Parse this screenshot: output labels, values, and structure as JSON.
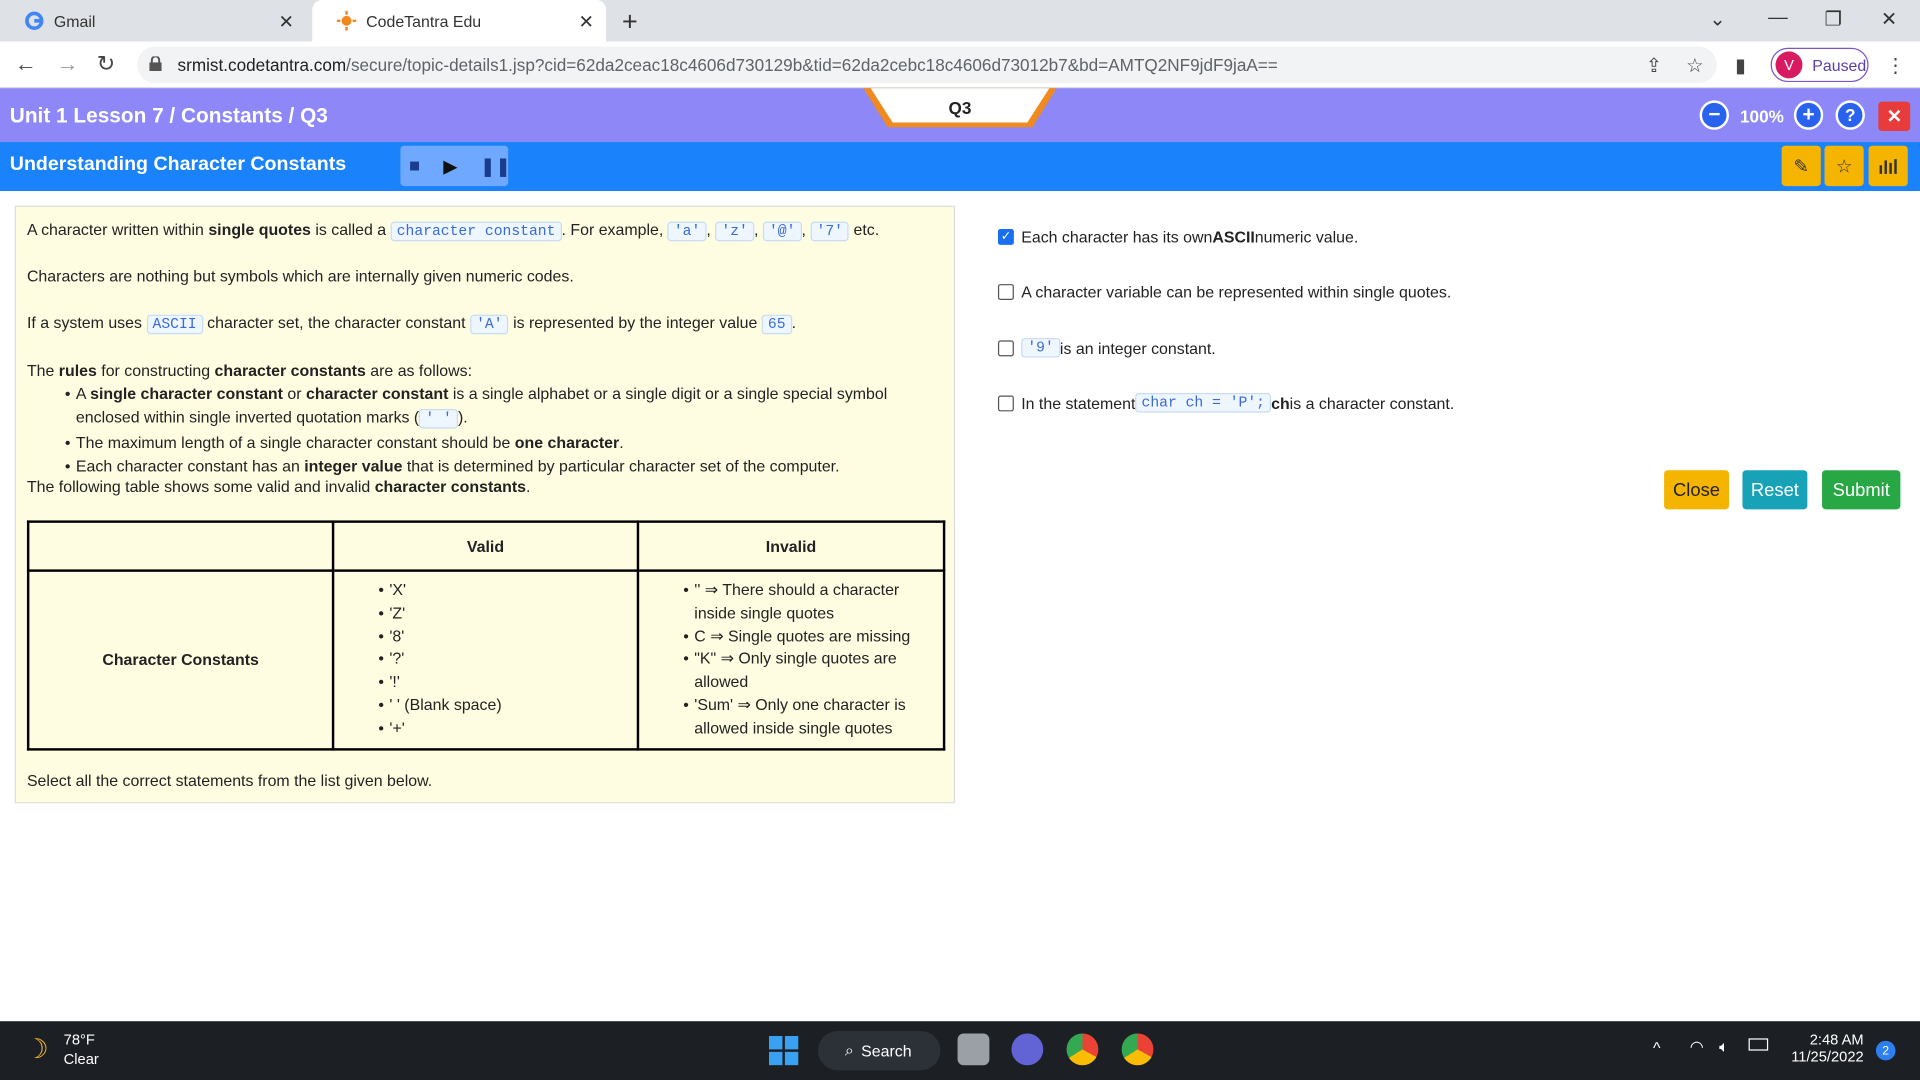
{
  "browser": {
    "tabs": [
      {
        "title": "Gmail"
      },
      {
        "title": "CodeTantra Edu"
      }
    ],
    "url_host": "srmist.codetantra.com",
    "url_path": "/secure/topic-details1.jsp?cid=62da2ceac18c4606d730129b&tid=62da2cebc18c4606d73012b7&bd=AMTQ2NF9jdF9jaA==",
    "profile_initial": "V",
    "profile_status": "Paused"
  },
  "lesson": {
    "breadcrumb": "Unit 1 Lesson 7 / Constants / Q3",
    "question_tab": "Q3",
    "zoom": "100%",
    "title": "Understanding Character Constants"
  },
  "content": {
    "p1_a": "A character written within ",
    "p1_b": "single quotes",
    "p1_c": " is called a ",
    "p1_code": "character constant",
    "p1_d": ". For example, ",
    "examples": [
      "'a'",
      "'z'",
      "'@'",
      "'7'"
    ],
    "p1_e": " etc.",
    "p2": "Characters are nothing but symbols which are internally given numeric codes.",
    "p3_a": "If a system uses ",
    "p3_code1": "ASCII",
    "p3_b": " character set, the character constant ",
    "p3_code2": "'A'",
    "p3_c": " is represented by the integer value ",
    "p3_code3": "65",
    "p3_d": ".",
    "p4_a": "The ",
    "p4_b": "rules",
    "p4_c": " for constructing ",
    "p4_d": "character constants",
    "p4_e": " are as follows:",
    "r1_a": "A ",
    "r1_b": "single character constant",
    "r1_c": " or ",
    "r1_d": "character constant",
    "r1_e": " is a single alphabet or a single digit or a single special symbol",
    "r1_f": "enclosed within single inverted quotation marks (",
    "r1_code": "' '",
    "r1_g": ").",
    "r2_a": "The maximum length of a single character constant should be ",
    "r2_b": "one character",
    "r2_c": ".",
    "r3_a": "Each character constant has an ",
    "r3_b": "integer value",
    "r3_c": " that is determined by particular character set of the computer.",
    "p5_a": "The following table shows some valid and invalid ",
    "p5_b": "character constants",
    "p5_c": ".",
    "table": {
      "col_valid": "Valid",
      "col_invalid": "Invalid",
      "row_header": "Character Constants",
      "valid": [
        "'X'",
        "'Z'",
        "'8'",
        "'?'",
        "'!'",
        "' ' (Blank space)",
        "'+'"
      ],
      "invalid": [
        "'' ⇒ There should a character",
        "inside single quotes",
        "C ⇒ Single quotes are missing",
        "\"K\" ⇒ Only single quotes are",
        "allowed",
        "'Sum' ⇒ Only one character is",
        "allowed inside single quotes"
      ]
    },
    "instruction": "Select all the correct statements from the list given below."
  },
  "options": [
    {
      "a": "Each character has its own ",
      "b": "ASCII",
      "c": " numeric value.",
      "checked": true
    },
    {
      "text": "A character variable can be represented within single quotes.",
      "checked": false
    },
    {
      "code": "'9'",
      "text": " is an integer constant.",
      "checked": false
    },
    {
      "a": "In the statement ",
      "code": "char ch = 'P';",
      "b": " ch",
      "c": " is a character constant.",
      "checked": false
    }
  ],
  "actions": {
    "close": "Close",
    "reset": "Reset",
    "submit": "Submit"
  },
  "colors": {
    "lesson_bar": "#8d87f7",
    "title_bar": "#1a82fa",
    "close": "#f4b400",
    "reset": "#17a2b8",
    "submit": "#28a745"
  },
  "taskbar": {
    "temp": "78°F",
    "weather": "Clear",
    "search": "Search",
    "time": "2:48 AM",
    "date": "11/25/2022",
    "notifications": "2"
  }
}
